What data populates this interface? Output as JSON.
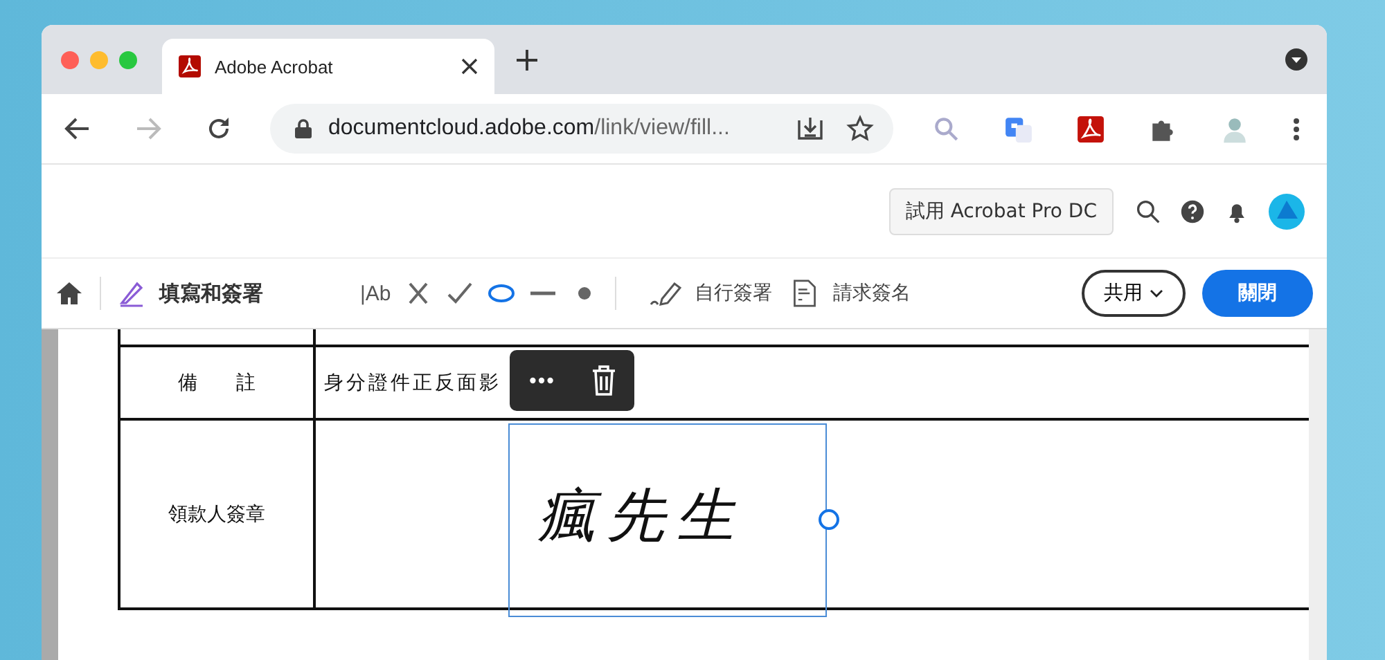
{
  "browser": {
    "tab": {
      "title": "Adobe Acrobat",
      "selected": true
    },
    "url": {
      "host": "documentcloud.adobe.com",
      "path": "/link/view/fill..."
    }
  },
  "header": {
    "trial_button": "試用 Acrobat Pro DC"
  },
  "toolbar": {
    "title": "填寫和簽署",
    "tools": [
      {
        "kind": "text",
        "label": "|Ab",
        "selected": false
      },
      {
        "kind": "cross",
        "selected": false
      },
      {
        "kind": "check",
        "selected": false
      },
      {
        "kind": "ellipse",
        "selected": true
      },
      {
        "kind": "line",
        "selected": false
      },
      {
        "kind": "dot",
        "selected": false
      }
    ],
    "sign_self": "自行簽署",
    "request_sign": "請求簽名",
    "share": "共用",
    "close": "關閉"
  },
  "document": {
    "rows": [
      {
        "label": "",
        "value": ""
      },
      {
        "label": "備　　註",
        "value": "身分證件正反面影"
      },
      {
        "label": "領款人簽章",
        "value": ""
      }
    ],
    "signature": "瘋先生"
  }
}
